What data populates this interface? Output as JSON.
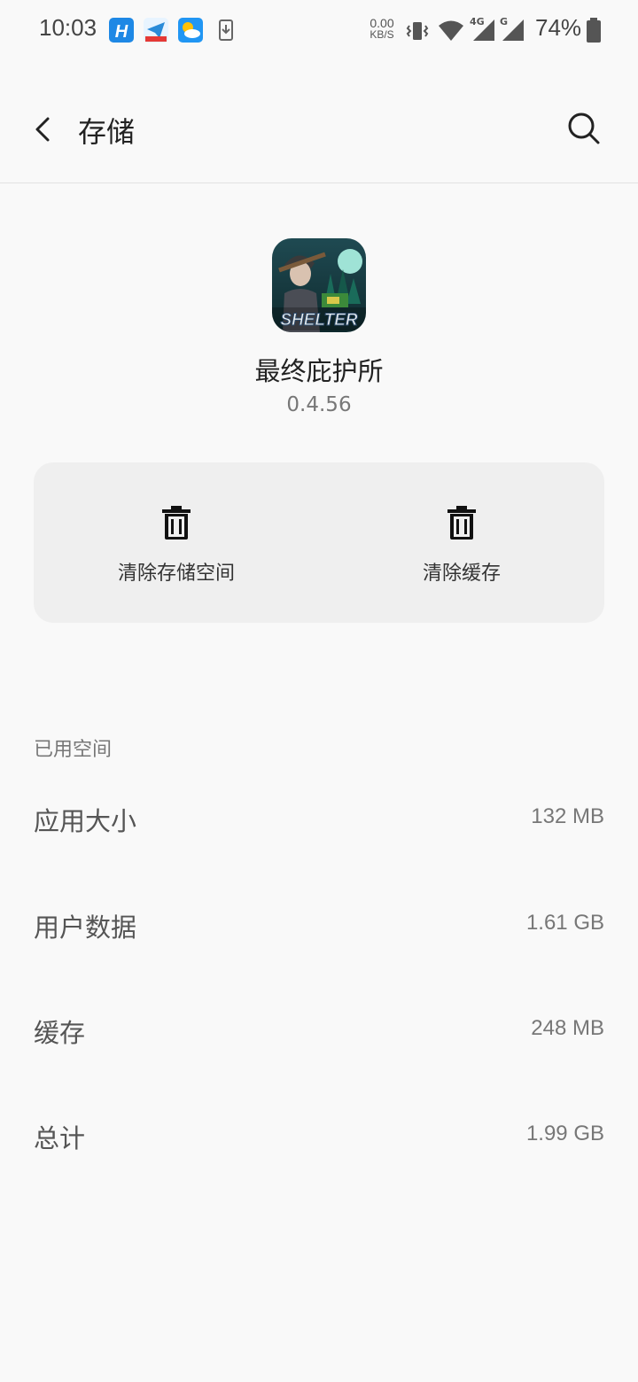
{
  "status_bar": {
    "time": "10:03",
    "net_speed_value": "0.00",
    "net_speed_unit": "KB/S",
    "signal_4g": "4G",
    "signal_g": "G",
    "battery": "74%",
    "icons": [
      "h-app-icon",
      "telegram-app-icon",
      "weather-app-icon",
      "download-icon",
      "vibrate-icon",
      "wifi-icon",
      "cell-signal-icon",
      "battery-icon"
    ]
  },
  "app_bar": {
    "title": "存储",
    "back_icon": "back-arrow-icon",
    "search_icon": "search-icon"
  },
  "app": {
    "name": "最终庇护所",
    "version": "0.4.56",
    "icon_text": "SHELTER"
  },
  "actions": {
    "clear_storage": "清除存储空间",
    "clear_cache": "清除缓存"
  },
  "used_space": {
    "header": "已用空间",
    "rows": [
      {
        "label": "应用大小",
        "value": "132 MB"
      },
      {
        "label": "用户数据",
        "value": "1.61 GB"
      },
      {
        "label": "缓存",
        "value": "248 MB"
      },
      {
        "label": "总计",
        "value": "1.99 GB"
      }
    ]
  }
}
